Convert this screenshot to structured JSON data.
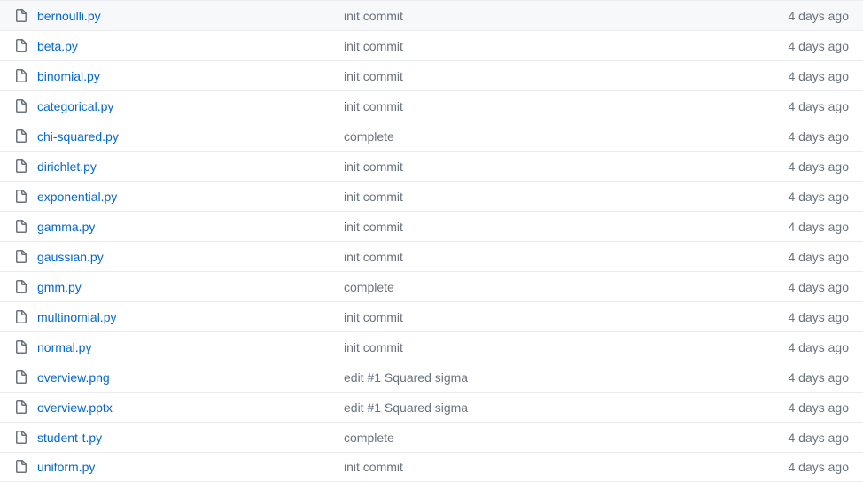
{
  "files": [
    {
      "name": "bernoulli.py",
      "commit": "init commit",
      "time": "4 days ago"
    },
    {
      "name": "beta.py",
      "commit": "init commit",
      "time": "4 days ago"
    },
    {
      "name": "binomial.py",
      "commit": "init commit",
      "time": "4 days ago"
    },
    {
      "name": "categorical.py",
      "commit": "init commit",
      "time": "4 days ago"
    },
    {
      "name": "chi-squared.py",
      "commit": "complete",
      "time": "4 days ago"
    },
    {
      "name": "dirichlet.py",
      "commit": "init commit",
      "time": "4 days ago"
    },
    {
      "name": "exponential.py",
      "commit": "init commit",
      "time": "4 days ago"
    },
    {
      "name": "gamma.py",
      "commit": "init commit",
      "time": "4 days ago"
    },
    {
      "name": "gaussian.py",
      "commit": "init commit",
      "time": "4 days ago"
    },
    {
      "name": "gmm.py",
      "commit": "complete",
      "time": "4 days ago"
    },
    {
      "name": "multinomial.py",
      "commit": "init commit",
      "time": "4 days ago"
    },
    {
      "name": "normal.py",
      "commit": "init commit",
      "time": "4 days ago"
    },
    {
      "name": "overview.png",
      "commit": "edit #1 Squared sigma",
      "time": "4 days ago"
    },
    {
      "name": "overview.pptx",
      "commit": "edit #1 Squared sigma",
      "time": "4 days ago"
    },
    {
      "name": "student-t.py",
      "commit": "complete",
      "time": "4 days ago"
    },
    {
      "name": "uniform.py",
      "commit": "init commit",
      "time": "4 days ago"
    }
  ]
}
